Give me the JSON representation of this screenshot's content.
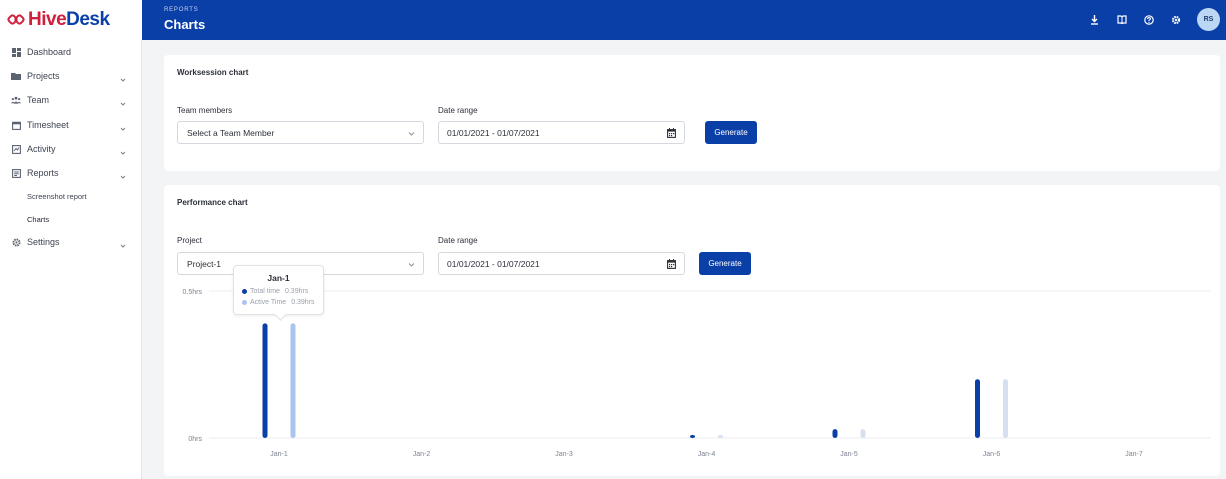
{
  "app": {
    "logo_prefix": "Hive",
    "logo_suffix": "Desk",
    "breadcrumb": "REPORTS",
    "page_title": "Charts",
    "user_initials": "RS",
    "brand_color": "#0b3fa8",
    "logo_accent_color": "#d11f3e"
  },
  "header_icons": [
    "download-icon",
    "book-icon",
    "help-icon",
    "settings-gear-icon"
  ],
  "sidebar": {
    "items": [
      {
        "label": "Dashboard",
        "icon": "dashboard-icon",
        "expandable": false
      },
      {
        "label": "Projects",
        "icon": "folder-icon",
        "expandable": true
      },
      {
        "label": "Team",
        "icon": "team-icon",
        "expandable": true
      },
      {
        "label": "Timesheet",
        "icon": "calendar-icon",
        "expandable": true
      },
      {
        "label": "Activity",
        "icon": "activity-icon",
        "expandable": true
      },
      {
        "label": "Reports",
        "icon": "reports-icon",
        "expandable": true
      },
      {
        "label": "Settings",
        "icon": "settings-icon",
        "expandable": true
      }
    ],
    "report_subitems": [
      "Screenshot report",
      "Charts"
    ]
  },
  "worksession": {
    "title": "Worksession chart",
    "team_label": "Team members",
    "team_placeholder": "Select a Team Member",
    "date_label": "Date range",
    "date_value": "01/01/2021 - 01/07/2021",
    "generate_label": "Generate"
  },
  "performance": {
    "title": "Performance chart",
    "project_label": "Project",
    "project_value": "Project-1",
    "date_label": "Date range",
    "date_value": "01/01/2021 - 01/07/2021",
    "generate_label": "Generate"
  },
  "tooltip": {
    "title": "Jan-1",
    "rows": [
      {
        "label": "Total time",
        "value": "0.39hrs",
        "color": "#0b3fa8"
      },
      {
        "label": "Active Time",
        "value": "0.39hrs",
        "color": "#a9c4ef"
      }
    ]
  },
  "chart_data": {
    "type": "bar",
    "categories": [
      "Jan-1",
      "Jan-2",
      "Jan-3",
      "Jan-4",
      "Jan-5",
      "Jan-6",
      "Jan-7"
    ],
    "series": [
      {
        "name": "Total time",
        "color": "#0b3fa8",
        "values": [
          0.39,
          0,
          0,
          0.01,
          0.03,
          0.2,
          0
        ]
      },
      {
        "name": "Active Time",
        "color": "#a9c4ef",
        "values": [
          0.39,
          0,
          0,
          0.01,
          0.03,
          0.2,
          0
        ]
      }
    ],
    "y_tick_labels": [
      "0hrs",
      "0.5hrs"
    ],
    "ylim": [
      0,
      0.5
    ],
    "grid": true
  }
}
